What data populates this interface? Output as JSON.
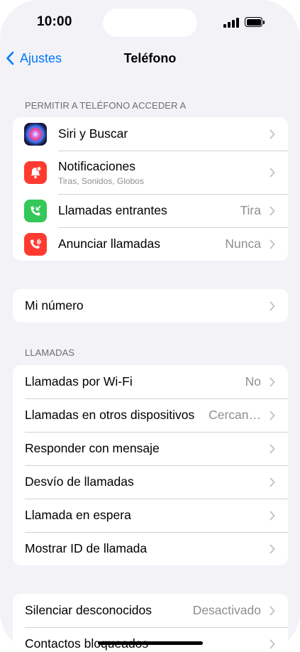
{
  "status_bar": {
    "time": "10:00"
  },
  "nav": {
    "back_label": "Ajustes",
    "title": "Teléfono"
  },
  "section_access": {
    "header": "PERMITIR A TELÉFONO ACCEDER A",
    "rows": [
      {
        "label": "Siri y Buscar",
        "icon": "siri-icon"
      },
      {
        "label": "Notificaciones",
        "sublabel": "Tiras, Sonidos, Globos",
        "icon": "bell-icon"
      },
      {
        "label": "Llamadas entrantes",
        "value": "Tira",
        "icon": "incoming-call-icon"
      },
      {
        "label": "Anunciar llamadas",
        "value": "Nunca",
        "icon": "announce-call-icon"
      }
    ]
  },
  "section_number": {
    "rows": [
      {
        "label": "Mi número"
      }
    ]
  },
  "section_calls": {
    "header": "LLAMADAS",
    "rows": [
      {
        "label": "Llamadas por Wi-Fi",
        "value": "No"
      },
      {
        "label": "Llamadas en otros dispositivos",
        "value": "Cercan…"
      },
      {
        "label": "Responder con mensaje"
      },
      {
        "label": "Desvío de llamadas"
      },
      {
        "label": "Llamada en espera"
      },
      {
        "label": "Mostrar ID de llamada"
      }
    ]
  },
  "section_block": {
    "rows": [
      {
        "label": "Silenciar desconocidos",
        "value": "Desactivado"
      },
      {
        "label": "Contactos bloqueados"
      }
    ]
  },
  "colors": {
    "accent": "#007aff",
    "background": "#f2f2f7",
    "secondary_text": "#8e8e93"
  }
}
